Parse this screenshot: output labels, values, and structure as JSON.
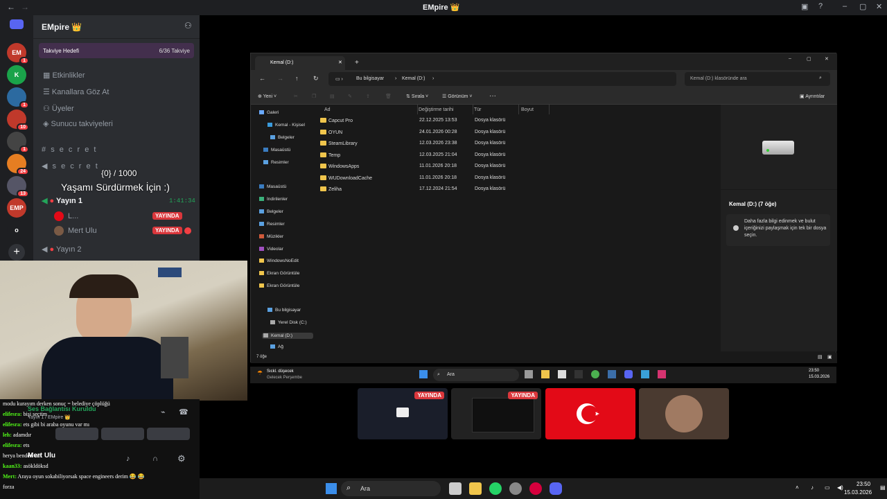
{
  "window": {
    "title": "EMpire 👑"
  },
  "rail": {
    "servers": [
      {
        "label": "EM",
        "badge": "1",
        "color": "#c0392b"
      },
      {
        "label": "K",
        "badge": "",
        "color": "#1aa34a"
      },
      {
        "label": "",
        "badge": "1",
        "color": "#2c6aa0"
      },
      {
        "label": "",
        "badge": "10",
        "color": "#c0392b"
      },
      {
        "label": "",
        "badge": "1",
        "color": "#444"
      },
      {
        "label": "",
        "badge": "24",
        "color": "#e67e22"
      },
      {
        "label": "",
        "badge": "13",
        "color": "#556"
      },
      {
        "label": "EMP",
        "badge": "",
        "color": "#c0392b"
      },
      {
        "label": "o",
        "badge": "",
        "color": "#1e1f22"
      }
    ],
    "add_label": "+"
  },
  "sidebar": {
    "server_name": "EMpire 👑",
    "boost_goal": "Takviye Hedefi",
    "boost_count": "6/36 Takviye",
    "items": [
      {
        "label": "Etkinlikler"
      },
      {
        "label": "Kanallara Göz At"
      },
      {
        "label": "Üyeler"
      },
      {
        "label": "Sunucu takviyeleri"
      }
    ],
    "channels": [
      {
        "label": "s e c r e t"
      },
      {
        "label": "s e c r e t"
      }
    ],
    "voice_channel_1": "Yayın 1",
    "voice_channel_1_time": "1:41:34",
    "voice_users": [
      {
        "name": "L...",
        "status": "YAYINDA"
      },
      {
        "name": "Mert Ulu",
        "status": "YAYINDA"
      }
    ],
    "voice_channel_2": "Yayın 2"
  },
  "overlay": {
    "counter": "{0} / 1000",
    "headline": "Yaşamı Sürdürmek İçin :)",
    "conn": "Ses Bağlantısı Kuruldu",
    "conn_sub": "Yayın 1 / EMpire 👑",
    "user": "Mert Ulu"
  },
  "chat": {
    "lines": [
      {
        "user": "",
        "text": "modu kurayım derken sonuç = belediye çöplüğü"
      },
      {
        "user": "elifesra:",
        "text": "bişi seçtim"
      },
      {
        "user": "elifesra:",
        "text": "ets gibi bi araba oyunu var mı"
      },
      {
        "user": "leh:",
        "text": "adamdır"
      },
      {
        "user": "elifesra:",
        "text": "ets"
      },
      {
        "user": "",
        "text": "herya benden var"
      },
      {
        "user": "kaan33:",
        "text": "asökldöksd"
      },
      {
        "user": "Mert:",
        "text": "Araya oyun sokabiliyorsak space engineers derim 😂 😂"
      },
      {
        "user": "",
        "text": "forza"
      }
    ]
  },
  "explorer": {
    "tab_title": "Kemal (D:)",
    "breadcrumb": [
      "Bu bilgisayar",
      "Kemal (D:)"
    ],
    "search_placeholder": "Kemal (D:) klasöründe ara",
    "toolbar": {
      "new": "Yeni",
      "sort": "Sırala",
      "view": "Görünüm",
      "details": "Ayrıntılar"
    },
    "nav": [
      {
        "label": "Galeri"
      },
      {
        "label": "Kemal - Kişisel"
      },
      {
        "label": "Belgeler"
      },
      {
        "label": "Masaüstü"
      },
      {
        "label": "Resimler"
      },
      {
        "label": "Masaüstü"
      },
      {
        "label": "İndirilenler"
      },
      {
        "label": "Belgeler"
      },
      {
        "label": "Resimler"
      },
      {
        "label": "Müzikler"
      },
      {
        "label": "Videolar"
      },
      {
        "label": "WindowsNoEdit"
      },
      {
        "label": "Ekran Görüntüle"
      },
      {
        "label": "Ekran Görüntüle"
      },
      {
        "label": "Bu bilgisayar"
      },
      {
        "label": "Yerel Disk (C:)"
      },
      {
        "label": "Kemal (D:)"
      },
      {
        "label": "Ağ"
      }
    ],
    "columns": [
      "Ad",
      "Değiştirme tarihi",
      "Tür",
      "Boyut"
    ],
    "rows": [
      {
        "name": "Capcut Pro",
        "date": "22.12.2025 13:53",
        "type": "Dosya klasörü"
      },
      {
        "name": "OYUN",
        "date": "24.01.2026 00:28",
        "type": "Dosya klasörü"
      },
      {
        "name": "SteamLibrary",
        "date": "12.03.2026 23:38",
        "type": "Dosya klasörü"
      },
      {
        "name": "Temp",
        "date": "12.03.2025 21:04",
        "type": "Dosya klasörü"
      },
      {
        "name": "WindowsApps",
        "date": "11.01.2026 20:18",
        "type": "Dosya klasörü"
      },
      {
        "name": "WUDownloadCache",
        "date": "11.01.2026 20:18",
        "type": "Dosya klasörü"
      },
      {
        "name": "Zeliha",
        "date": "17.12.2024 21:54",
        "type": "Dosya klasörü"
      }
    ],
    "detail_title": "Kemal (D:) (7 öğe)",
    "detail_text": "Daha fazla bilgi edinmek ve bulut içeriğinizi paylaşmak için tek bir dosya seçin.",
    "status": "7 öğe"
  },
  "inner_taskbar": {
    "weather": "Sıckl. düşecek",
    "weather_sub": "Gelecek Perşembe",
    "search": "Ara",
    "time": "23:50",
    "date": "15.03.2026"
  },
  "thumbs": [
    {
      "status": "YAYINDA"
    },
    {
      "status": "YAYINDA"
    }
  ],
  "taskbar": {
    "search": "Ara",
    "time": "23:50",
    "date": "15.03.2026"
  }
}
